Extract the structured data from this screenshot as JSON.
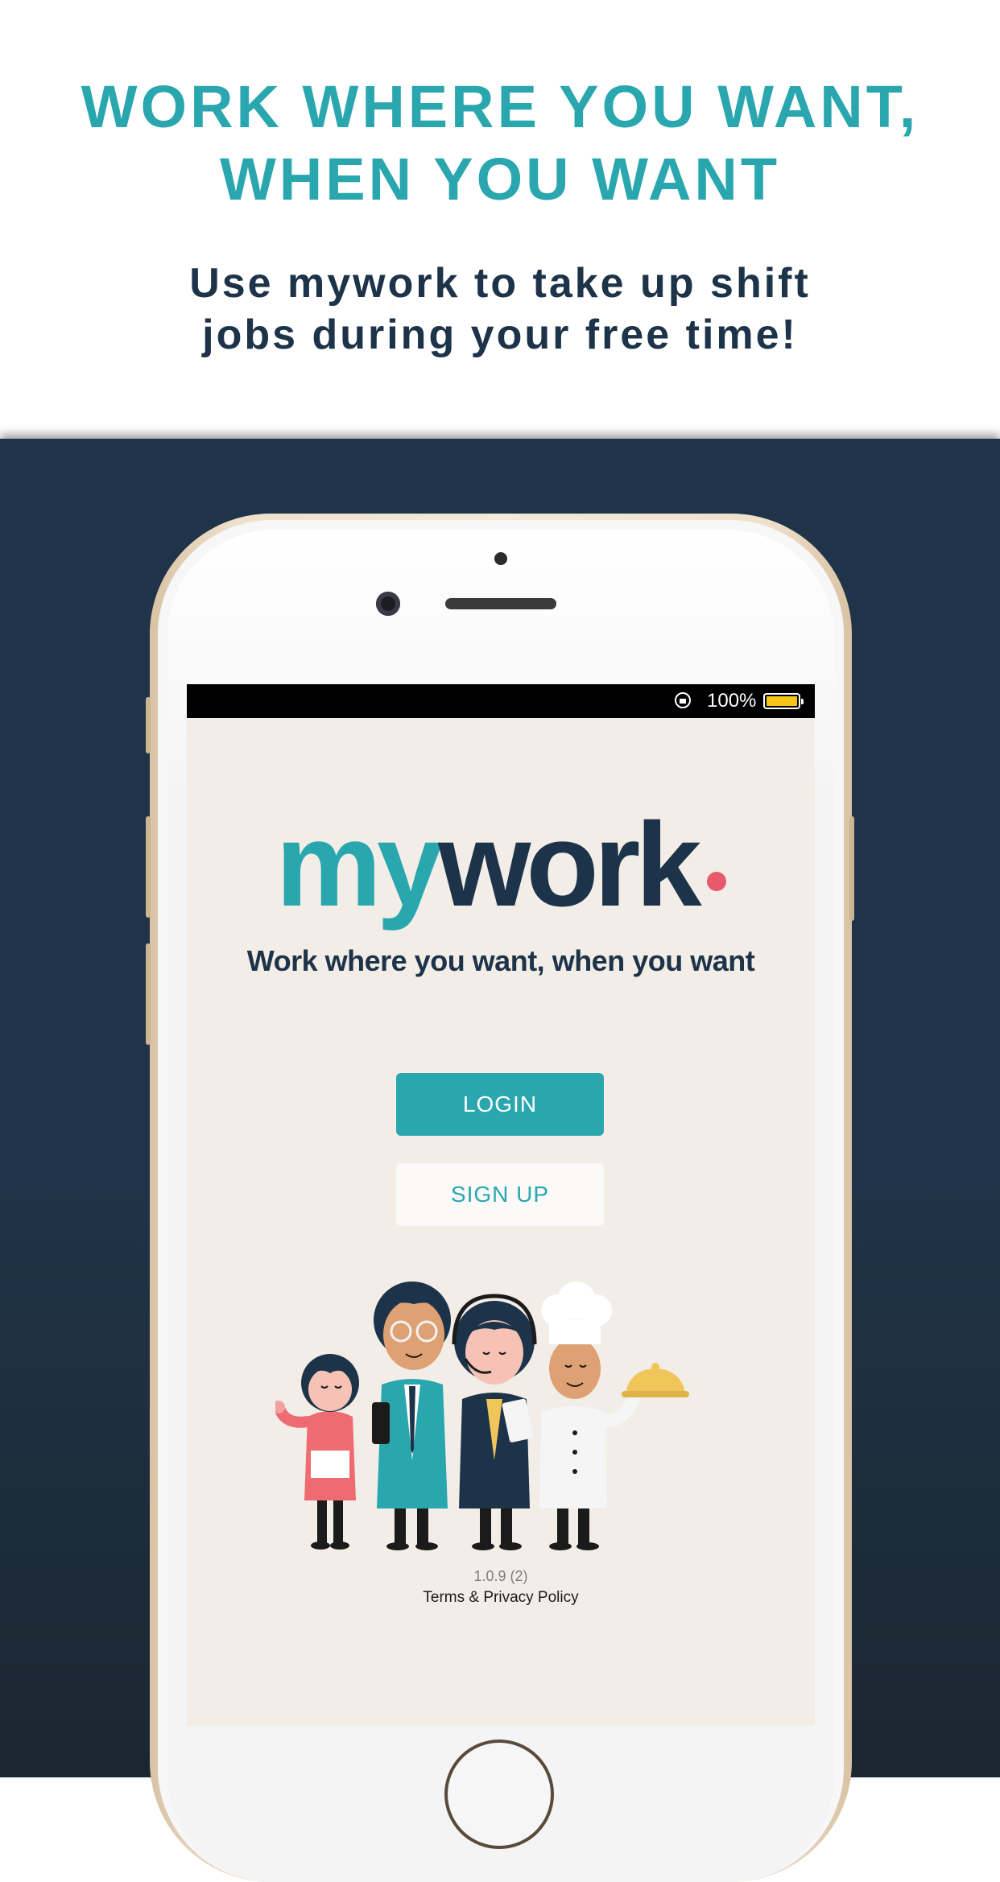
{
  "header": {
    "headline_line1": "WORK WHERE YOU WANT,",
    "headline_line2": "WHEN YOU WANT",
    "sub_line1": "Use mywork to take up shift",
    "sub_line2": "jobs during your free time!"
  },
  "statusbar": {
    "battery_percent": "100%",
    "icons": [
      "orientation-lock-icon",
      "battery-icon"
    ]
  },
  "app": {
    "logo_part1": "my",
    "logo_part2": "work",
    "tagline": "Work where you want, when you want",
    "login_label": "LOGIN",
    "signup_label": "SIGN UP",
    "version": "1.0.9 (2)",
    "terms_link": "Terms & Privacy Policy"
  },
  "colors": {
    "teal": "#2aa7ae",
    "navy": "#1d3349",
    "screen_bg": "#f2ede7",
    "logo_dot": "#e85a6b",
    "battery": "#f5c518"
  }
}
